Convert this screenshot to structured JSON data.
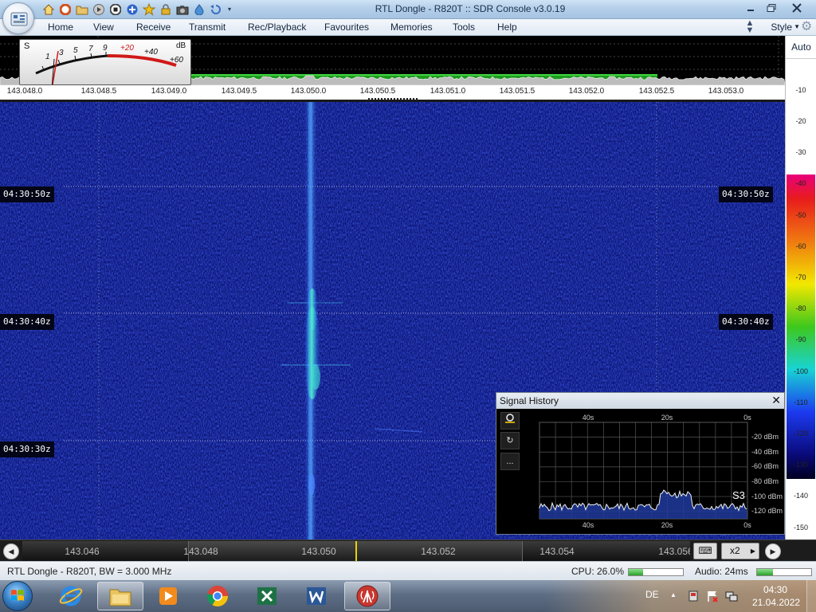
{
  "window": {
    "title": "RTL Dongle - R820T :: SDR Console v3.0.19",
    "controls": [
      "minimize",
      "maximize",
      "close"
    ]
  },
  "quick_access": [
    "home-icon",
    "help-icon",
    "folder-icon",
    "play-icon",
    "stop-icon",
    "add-icon",
    "star-icon",
    "lock-icon",
    "camera-icon",
    "drop-icon",
    "undo-icon"
  ],
  "menu": {
    "items": [
      "Home",
      "View",
      "Receive",
      "Transmit",
      "Rec/Playback",
      "Favourites",
      "Memories",
      "Tools",
      "Help"
    ],
    "style_label": "Style"
  },
  "smeter": {
    "s_label": "S",
    "db_label": "dB",
    "s_scale": [
      "1",
      "3",
      "5",
      "7",
      "9"
    ],
    "db_scale": [
      "+20",
      "+40",
      "+60"
    ]
  },
  "frequency_axis": [
    "143.048.0",
    "143.048.5",
    "143.049.0",
    "143.049.5",
    "143.050.0",
    "143.050.5",
    "143.051.0",
    "143.051.5",
    "143.052.0",
    "143.052.5",
    "143.053.0"
  ],
  "db_scale": {
    "auto_label": "Auto",
    "values": [
      "-10",
      "-20",
      "-30",
      "-40",
      "-50",
      "-60",
      "-70",
      "-80",
      "-90",
      "-100",
      "-110",
      "-120",
      "-130",
      "-140",
      "-150"
    ]
  },
  "waterfall": {
    "timestamps": [
      "04:30:50z",
      "04:30:40z",
      "04:30:30z"
    ]
  },
  "signal_history": {
    "title": "Signal History",
    "x_labels": [
      "40s",
      "20s",
      "0s"
    ],
    "y_labels": [
      "-20 dBm",
      "-40 dBm",
      "-60 dBm",
      "-80 dBm",
      "-100 dBm",
      "-120 dBm"
    ],
    "s_reading": "S3",
    "tools": [
      "record-icon",
      "refresh-icon",
      "more-icon"
    ],
    "more_label": "..."
  },
  "tuning": {
    "labels": [
      "143.046",
      "143.048",
      "143.050",
      "143.052",
      "143.054",
      "143.056"
    ],
    "zoom_label": "x2"
  },
  "status": {
    "device": "RTL Dongle - R820T, BW = 3.000 MHz",
    "cpu": "CPU: 26.0%",
    "cpu_level": 0.26,
    "audio": "Audio: 24ms",
    "audio_level": 0.3
  },
  "taskbar": {
    "apps": [
      "internet-explorer-icon",
      "explorer-icon",
      "media-player-icon",
      "chrome-icon",
      "excel-icon",
      "word-icon",
      "sdr-console-icon"
    ],
    "language": "DE",
    "time": "04:30",
    "date": "21.04.2022"
  },
  "colors": {
    "waterfall_bg": "#0c1574",
    "signal": "#3fe0d0",
    "accent": "#e8d200"
  }
}
